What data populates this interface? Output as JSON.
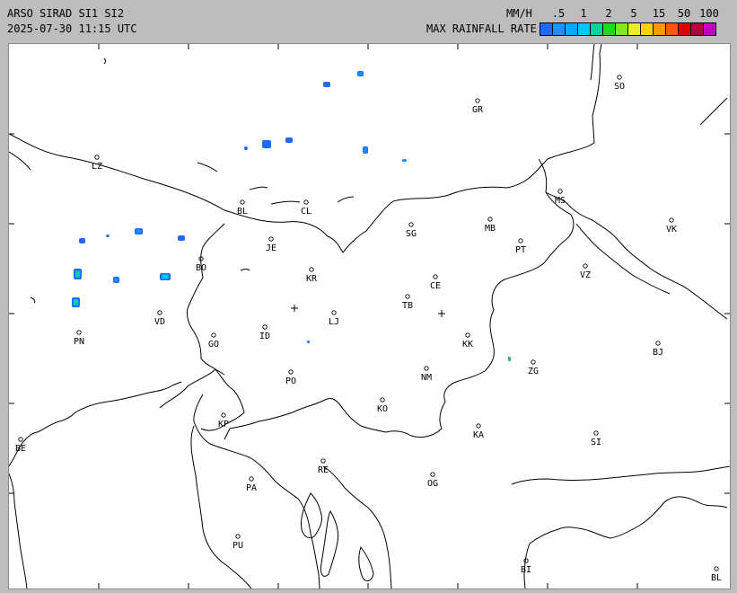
{
  "header": {
    "title": "ARSO SIRAD SI1 SI2",
    "timestamp": "2025-07-30 11:15 UTC",
    "unit_label": "MM/H",
    "legend_label": "MAX RAINFALL RATE"
  },
  "legend": {
    "ticks": [
      ".5",
      "1",
      "2",
      "5",
      "15",
      "50",
      "100"
    ],
    "colors": [
      "#1e6cff",
      "#1e90ff",
      "#00aaff",
      "#00c8ff",
      "#00d2a0",
      "#20d820",
      "#80e820",
      "#e8f020",
      "#ffd000",
      "#ff9a00",
      "#ff5a00",
      "#e00000",
      "#b00040",
      "#c000c0"
    ]
  },
  "cities": [
    {
      "code": "SO"
    },
    {
      "code": "GR"
    },
    {
      "code": "LZ"
    },
    {
      "code": "BL"
    },
    {
      "code": "CL"
    },
    {
      "code": "MS"
    },
    {
      "code": "MB"
    },
    {
      "code": "VK"
    },
    {
      "code": "JE"
    },
    {
      "code": "SG"
    },
    {
      "code": "PT"
    },
    {
      "code": "BO"
    },
    {
      "code": "KR"
    },
    {
      "code": "CE"
    },
    {
      "code": "VZ"
    },
    {
      "code": "TB"
    },
    {
      "code": "VD"
    },
    {
      "code": "LJ"
    },
    {
      "code": "PN"
    },
    {
      "code": "GO"
    },
    {
      "code": "ID"
    },
    {
      "code": "KK"
    },
    {
      "code": "BJ"
    },
    {
      "code": "NM"
    },
    {
      "code": "ZG"
    },
    {
      "code": "PO"
    },
    {
      "code": "KO"
    },
    {
      "code": "KP"
    },
    {
      "code": "KA"
    },
    {
      "code": "SI"
    },
    {
      "code": "BE"
    },
    {
      "code": "RE"
    },
    {
      "code": "PA"
    },
    {
      "code": "OG"
    },
    {
      "code": "PU"
    },
    {
      "code": "BI"
    },
    {
      "code": "BL"
    }
  ],
  "radars": [
    {
      "name": "SI1"
    },
    {
      "name": "SI2"
    }
  ],
  "rain_cells": [
    {
      "level": 2
    },
    {
      "level": 1
    },
    {
      "level": 1
    },
    {
      "level": 1
    },
    {
      "level": 1
    },
    {
      "level": 2
    },
    {
      "level": 3
    },
    {
      "level": 1
    },
    {
      "level": 1
    },
    {
      "level": 2
    },
    {
      "level": 1
    },
    {
      "level": 5
    },
    {
      "level": 5
    },
    {
      "level": 4
    },
    {
      "level": 2
    },
    {
      "level": 1
    },
    {
      "level": 6
    }
  ]
}
